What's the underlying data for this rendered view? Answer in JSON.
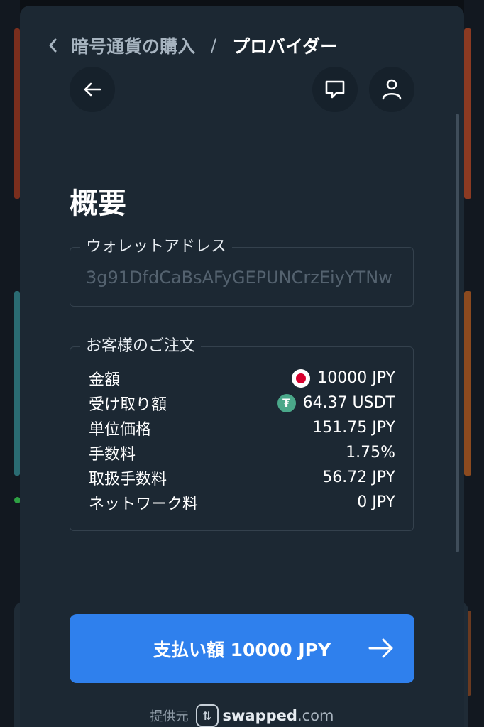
{
  "header": {
    "parent_crumb": "暗号通貨の購入",
    "separator": "/",
    "current_crumb": "プロバイダー"
  },
  "summary": {
    "title": "概要"
  },
  "wallet": {
    "legend": "ウォレットアドレス",
    "address": "3g91DfdCaBsAFyGEPUNCrzEiyYTNw"
  },
  "order": {
    "legend": "お客様のご注文",
    "rows": [
      {
        "label": "金額",
        "value": "10000 JPY",
        "icon": "jp-flag-icon"
      },
      {
        "label": "受け取り額",
        "value": "64.37 USDT",
        "icon": "tether-icon"
      },
      {
        "label": "単位価格",
        "value": "151.75 JPY"
      },
      {
        "label": "手数料",
        "value": "1.75%"
      },
      {
        "label": "取扱手数料",
        "value": "56.72 JPY"
      },
      {
        "label": "ネットワーク料",
        "value": "0 JPY"
      }
    ]
  },
  "pay_button": {
    "label": "支払い額 10000 JPY"
  },
  "footer": {
    "label": "提供元",
    "brand": "swapped",
    "brand_tld": ".com"
  },
  "colors": {
    "modal_bg": "#1c2833",
    "accent": "#2f80ed",
    "muted_text": "#54626f",
    "jp_red": "#d7002e",
    "tether_green": "#4aa88a"
  }
}
